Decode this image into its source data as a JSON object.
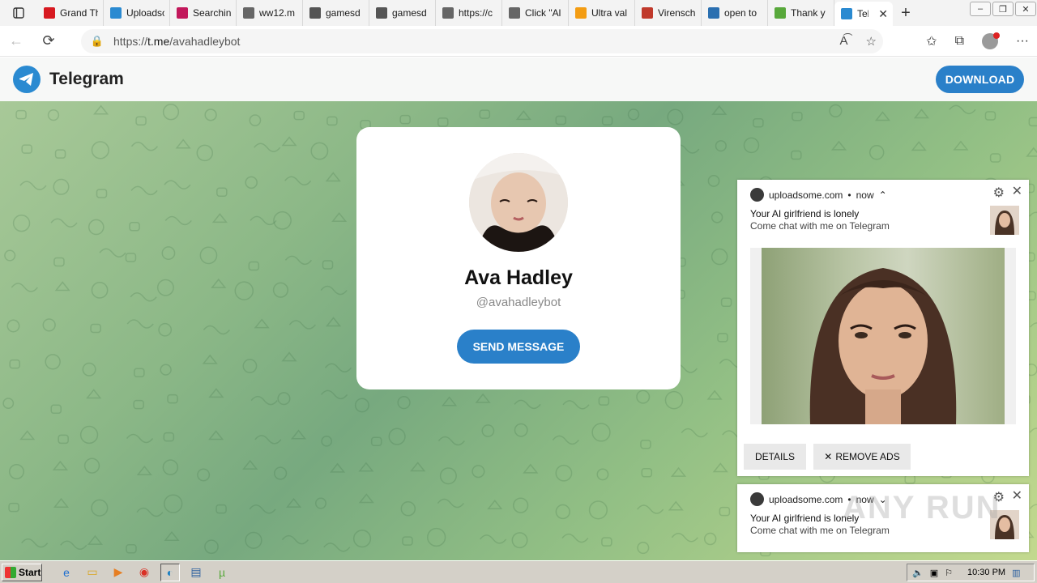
{
  "browser": {
    "tabs": [
      {
        "title": "Grand Th",
        "icon": "red-app-icon",
        "color": "#d71920"
      },
      {
        "title": "Uploadso",
        "icon": "upload-icon",
        "color": "#2a8ad1"
      },
      {
        "title": "Searchin",
        "icon": "squares-icon",
        "color": "#c2185b"
      },
      {
        "title": "ww12.m",
        "icon": "page-icon",
        "color": "#666666"
      },
      {
        "title": "gamesd",
        "icon": "game-icon",
        "color": "#555555"
      },
      {
        "title": "gamesd",
        "icon": "game-icon",
        "color": "#555555"
      },
      {
        "title": "https://c",
        "icon": "page-icon",
        "color": "#666666"
      },
      {
        "title": "Click \"Al",
        "icon": "page-icon",
        "color": "#666666"
      },
      {
        "title": "Ultra val",
        "icon": "bolt-icon",
        "color": "#f39c12"
      },
      {
        "title": "Virensch",
        "icon": "mcafee-icon",
        "color": "#c0392b"
      },
      {
        "title": "open to",
        "icon": "search-icon",
        "color": "#2a6fb0"
      },
      {
        "title": "Thank y",
        "icon": "torrent-icon",
        "color": "#58a83b"
      },
      {
        "title": "Tele",
        "icon": "telegram-icon",
        "color": "#2a8ad1",
        "active": true
      }
    ],
    "url_prefix": "https://",
    "url_host": "t.me",
    "url_path": "/avahadleybot"
  },
  "telegram": {
    "brand": "Telegram",
    "download_label": "DOWNLOAD",
    "profile_name": "Ava Hadley",
    "profile_handle": "@avahadleybot",
    "send_label": "SEND MESSAGE",
    "accent": "#2a80c9"
  },
  "notifications": [
    {
      "source": "uploadsome.com",
      "time": "now",
      "title": "Your AI girlfriend is lonely",
      "body": "Come chat with me on Telegram",
      "details_label": "DETAILS",
      "remove_label": "REMOVE ADS"
    },
    {
      "source": "uploadsome.com",
      "time": "now",
      "title": "Your AI girlfriend is lonely",
      "body": "Come chat with me on Telegram"
    }
  ],
  "watermark": "ANY RUN",
  "taskbar": {
    "start_label": "Start",
    "clock": "10:30 PM"
  }
}
